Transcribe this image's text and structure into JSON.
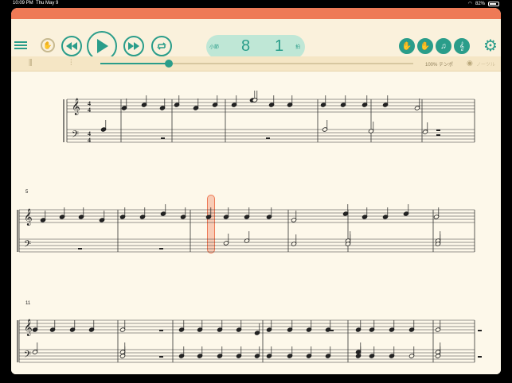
{
  "status": {
    "time": "10:09 PM",
    "date": "Thu May 9",
    "battery": "82%",
    "battery_level": 0.82,
    "wifi_icon": "wifi-icon"
  },
  "colors": {
    "accent": "#2a9d8a",
    "header": "#ee7a56",
    "paper": "#fdf8ea"
  },
  "toolbar": {
    "menu_icon": "hamburger-menu-icon",
    "metronome_icon": "hand-metronome-icon",
    "rewind_icon": "rewind-icon",
    "play_icon": "play-icon",
    "fastforward_icon": "fast-forward-icon",
    "loop_icon": "loop-icon",
    "counter": {
      "measure_label": "小節",
      "measure": "8",
      "beat": "1",
      "beat_label": "拍"
    },
    "right_icons": [
      "hand-icon",
      "hand-right-icon",
      "music-note-icon",
      "clef-icon",
      "gear-icon"
    ]
  },
  "subbar": {
    "tempo_label": "100% テンポ",
    "tempo_value": 1.0,
    "hide_label": "ノーツル",
    "slider_position": 0.22
  },
  "score": {
    "measure_numbers": [
      "5",
      "11"
    ],
    "highlighted_measure": "8"
  }
}
